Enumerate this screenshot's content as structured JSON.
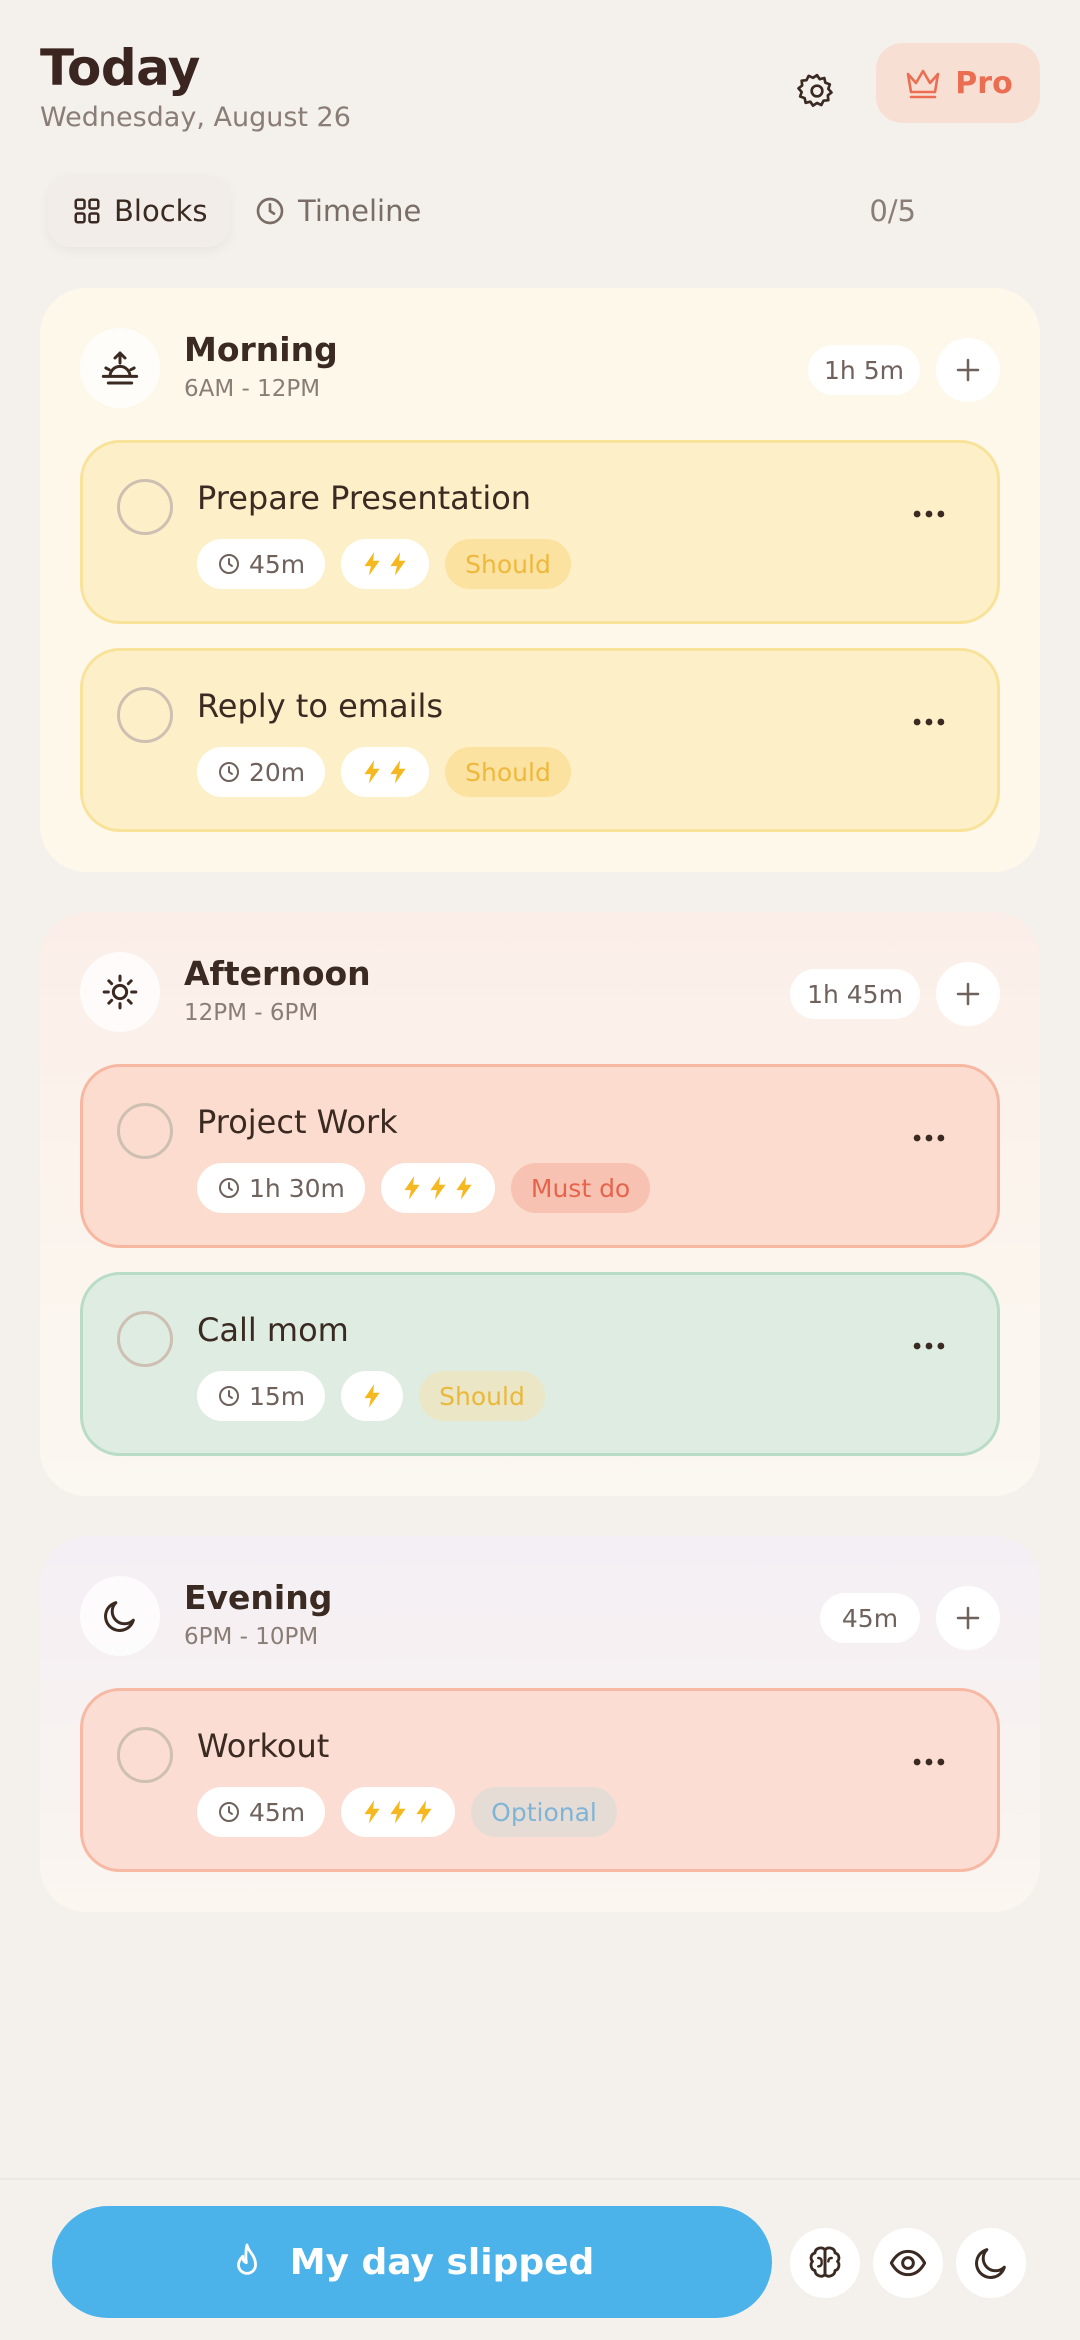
{
  "header": {
    "title": "Today",
    "date": "Wednesday, August 26",
    "pro_label": "Pro"
  },
  "tabs": [
    {
      "label": "Blocks",
      "icon": "grid-icon",
      "active": true
    },
    {
      "label": "Timeline",
      "icon": "clock-icon",
      "active": false
    }
  ],
  "progress": "0/5",
  "blocks": [
    {
      "name": "Morning",
      "range": "6AM - 12PM",
      "duration": "1h 5m",
      "icon": "sunrise-icon",
      "tasks": [
        {
          "title": "Prepare Presentation",
          "time": "45m",
          "energy": 2,
          "priority": "Should",
          "color": "#fdf0c9"
        },
        {
          "title": "Reply to emails",
          "time": "20m",
          "energy": 2,
          "priority": "Should",
          "color": "#fdf0c9"
        }
      ]
    },
    {
      "name": "Afternoon",
      "range": "12PM - 6PM",
      "duration": "1h 45m",
      "icon": "sun-icon",
      "tasks": [
        {
          "title": "Project Work",
          "time": "1h 30m",
          "energy": 3,
          "priority": "Must do",
          "color": "#fcdccf"
        },
        {
          "title": "Call mom",
          "time": "15m",
          "energy": 1,
          "priority": "Should",
          "color": "#dfece2"
        }
      ]
    },
    {
      "name": "Evening",
      "range": "6PM - 10PM",
      "duration": "45m",
      "icon": "moon-icon",
      "tasks": [
        {
          "title": "Workout",
          "time": "45m",
          "energy": 3,
          "priority": "Optional",
          "color": "#fbddd3"
        }
      ]
    }
  ],
  "bottom": {
    "slip_label": "My day slipped",
    "accent": "#4bb2ea"
  }
}
